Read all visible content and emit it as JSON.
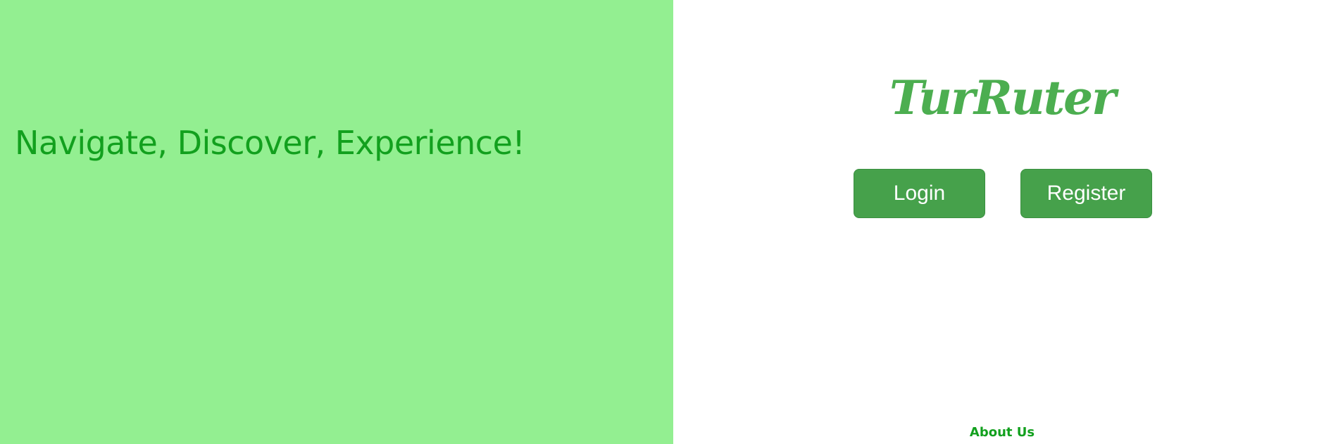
{
  "hero": {
    "tagline": "Navigate, Discover, Experience!"
  },
  "brand": {
    "logo_text": "TurRuter"
  },
  "auth": {
    "login_label": "Login",
    "register_label": "Register"
  },
  "footer": {
    "about_label": "About Us"
  },
  "colors": {
    "hero_background": "#93ef91",
    "tagline_text": "#12a01e",
    "brand_green": "#4cae50",
    "button_background": "#46a14b",
    "button_text": "#ffffff",
    "link_text": "#12a01e"
  }
}
